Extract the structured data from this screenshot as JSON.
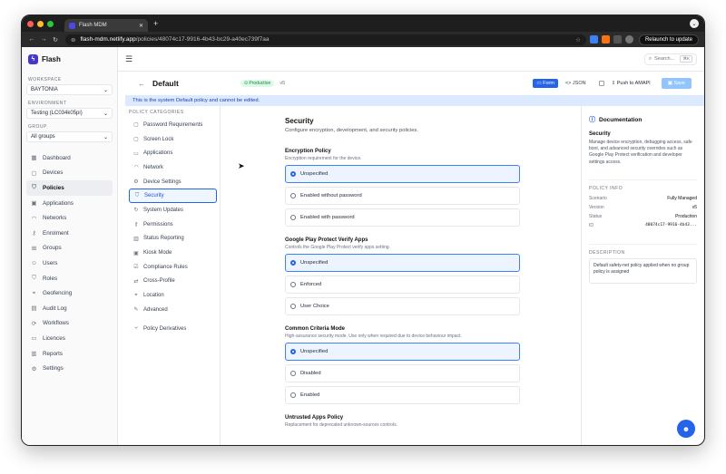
{
  "browser": {
    "tab_title": "Flash MDM",
    "url_host": "flash-mdm.netlify.app",
    "url_path": "/policies/48074c17-9916-4b43-bc29-a40ec739f7aa",
    "relaunch_label": "Relaunch to update"
  },
  "sidebar": {
    "brand": "Flash",
    "workspace_label": "WORKSPACE",
    "workspace_value": "BAYTONIA",
    "environment_label": "ENVIRONMENT",
    "environment_value": "Testing (LC034k05pi)",
    "group_label": "GROUP",
    "group_value": "All groups",
    "items": [
      {
        "label": "Dashboard",
        "icon": "▦"
      },
      {
        "label": "Devices",
        "icon": "▢"
      },
      {
        "label": "Policies",
        "icon": "⛉"
      },
      {
        "label": "Applications",
        "icon": "▣"
      },
      {
        "label": "Networks",
        "icon": "◠"
      },
      {
        "label": "Enrolment",
        "icon": "⚷"
      },
      {
        "label": "Groups",
        "icon": "⊞"
      },
      {
        "label": "Users",
        "icon": "☺"
      },
      {
        "label": "Roles",
        "icon": "⛉"
      },
      {
        "label": "Geofencing",
        "icon": "⌖"
      },
      {
        "label": "Audit Log",
        "icon": "▤"
      },
      {
        "label": "Workflows",
        "icon": "⟳"
      },
      {
        "label": "Licences",
        "icon": "▭"
      },
      {
        "label": "Reports",
        "icon": "▥"
      },
      {
        "label": "Settings",
        "icon": "⚙"
      }
    ]
  },
  "topbar": {
    "search_placeholder": "Search...",
    "search_kbd": "⌘K"
  },
  "policy": {
    "title": "Default",
    "status_badge": "Production",
    "version": "v5",
    "form_label": "Form",
    "json_label": "JSON",
    "push_label": "Push to AMAPI",
    "save_label": "Save",
    "notice": "This is the system Default policy and cannot be edited."
  },
  "categories": {
    "heading": "POLICY CATEGORIES",
    "items": [
      {
        "label": "Password Requirements",
        "icon": "▢"
      },
      {
        "label": "Screen Lock",
        "icon": "▢"
      },
      {
        "label": "Applications",
        "icon": "▭"
      },
      {
        "label": "Network",
        "icon": "◠"
      },
      {
        "label": "Device Settings",
        "icon": "⚙"
      },
      {
        "label": "Security",
        "icon": "⛉"
      },
      {
        "label": "System Updates",
        "icon": "↻"
      },
      {
        "label": "Permissions",
        "icon": "⚷"
      },
      {
        "label": "Status Reporting",
        "icon": "▥"
      },
      {
        "label": "Kiosk Mode",
        "icon": "▣"
      },
      {
        "label": "Compliance Rules",
        "icon": "☑"
      },
      {
        "label": "Cross-Profile",
        "icon": "⇄"
      },
      {
        "label": "Location",
        "icon": "⌖"
      },
      {
        "label": "Advanced",
        "icon": "✎"
      }
    ],
    "derivatives": {
      "label": "Policy Derivatives",
      "icon": "⑂"
    }
  },
  "security": {
    "title": "Security",
    "description": "Configure encryption, development, and security policies.",
    "groups": [
      {
        "title": "Encryption Policy",
        "description": "Encryption requirement for the device.",
        "options": [
          "Unspecified",
          "Enabled without password",
          "Enabled with password"
        ]
      },
      {
        "title": "Google Play Protect Verify Apps",
        "description": "Controls the Google Play Protect verify apps setting.",
        "options": [
          "Unspecified",
          "Enforced",
          "User Choice"
        ]
      },
      {
        "title": "Common Criteria Mode",
        "description": "High-assurance security mode. Use only when required due to device behaviour impact.",
        "options": [
          "Unspecified",
          "Disabled",
          "Enabled"
        ]
      },
      {
        "title": "Untrusted Apps Policy",
        "description": "Replacement for deprecated unknown-sources controls."
      }
    ]
  },
  "docs": {
    "title": "Documentation",
    "subtitle": "Security",
    "text": "Manage device encryption, debugging access, safe boot, and advanced security overrides such as Google Play Protect verification and developer settings access.",
    "info_label": "POLICY INFO",
    "info": [
      {
        "k": "Scenario",
        "v": "Fully Managed"
      },
      {
        "k": "Version",
        "v": "v5"
      },
      {
        "k": "Status",
        "v": "Production"
      },
      {
        "k": "ID",
        "v": "48074c17-9916-4b43..."
      }
    ],
    "desc_label": "DESCRIPTION",
    "desc_text": "Default safety-net policy applied when no group policy is assigned"
  }
}
